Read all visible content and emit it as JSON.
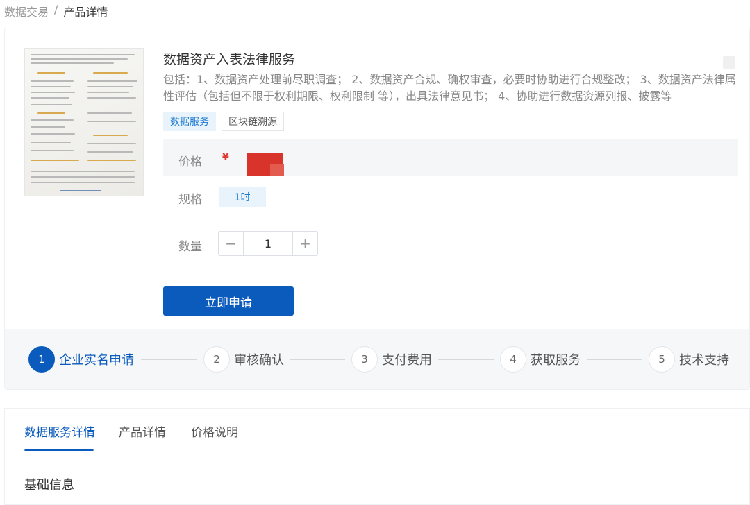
{
  "breadcrumb": {
    "parent": "数据交易",
    "sep": "/",
    "current": "产品详情"
  },
  "product": {
    "title": "数据资产入表法律服务",
    "description": "包括：1、数据资产处理前尽职调查； 2、数据资产合规、确权审查，必要时协助进行合规整改； 3、数据资产法律属性评估（包括但不限于权利期限、权利限制 等），出具法律意见书； 4、协助进行数据资源列报、披露等",
    "tags": [
      "数据服务",
      "区块链溯源"
    ]
  },
  "purchase": {
    "price_label": "价格",
    "currency": "¥",
    "spec_label": "规格",
    "spec_value": "1时",
    "qty_label": "数量",
    "qty_value": "1",
    "minus": "−",
    "plus": "+",
    "apply_label": "立即申请"
  },
  "steps": [
    {
      "num": "1",
      "label": "企业实名申请",
      "active": true
    },
    {
      "num": "2",
      "label": "审核确认",
      "active": false
    },
    {
      "num": "3",
      "label": "支付费用",
      "active": false
    },
    {
      "num": "4",
      "label": "获取服务",
      "active": false
    },
    {
      "num": "5",
      "label": "技术支持",
      "active": false
    }
  ],
  "tabs": [
    "数据服务详情",
    "产品详情",
    "价格说明"
  ],
  "active_tab": 0,
  "section_title": "基础信息",
  "colors": {
    "primary": "#0b5bbd",
    "price_red": "#e0362f",
    "tag_blue": "#1f7bd1"
  }
}
